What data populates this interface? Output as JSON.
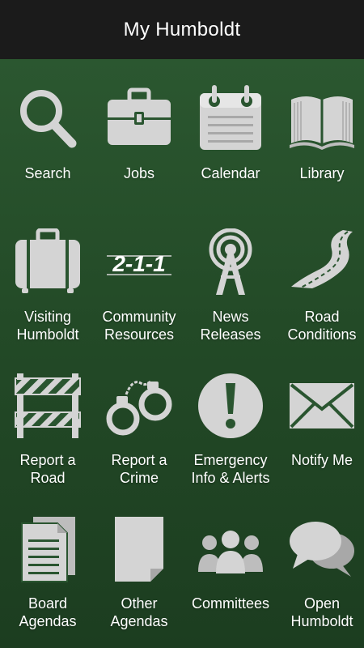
{
  "header": {
    "title": "My Humboldt"
  },
  "colors": {
    "icon": "#d4d4d4",
    "background": "#2a5530",
    "header": "#1b1b1b"
  },
  "tiles": [
    {
      "label": "Search",
      "icon": "search-icon"
    },
    {
      "label": "Jobs",
      "icon": "briefcase-icon"
    },
    {
      "label": "Calendar",
      "icon": "calendar-icon"
    },
    {
      "label": "Library",
      "icon": "book-icon"
    },
    {
      "label": "Visiting\nHumboldt",
      "icon": "suitcase-icon"
    },
    {
      "label": "Community\nResources",
      "icon": "211-icon",
      "icon_text": "2-1-1"
    },
    {
      "label": "News\nReleases",
      "icon": "broadcast-tower-icon"
    },
    {
      "label": "Road\nConditions",
      "icon": "road-icon"
    },
    {
      "label": "Report a\nRoad",
      "icon": "road-barrier-icon"
    },
    {
      "label": "Report a\nCrime",
      "icon": "handcuffs-icon"
    },
    {
      "label": "Emergency\nInfo & Alerts",
      "icon": "alert-icon"
    },
    {
      "label": "Notify Me",
      "icon": "envelope-icon"
    },
    {
      "label": "Board\nAgendas",
      "icon": "documents-icon"
    },
    {
      "label": "Other\nAgendas",
      "icon": "document-icon"
    },
    {
      "label": "Committees",
      "icon": "people-icon"
    },
    {
      "label": "Open\nHumboldt",
      "icon": "chat-bubbles-icon"
    }
  ]
}
